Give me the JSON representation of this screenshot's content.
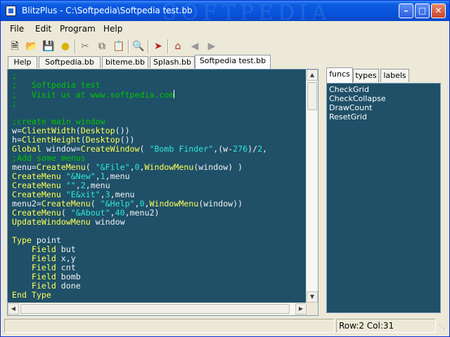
{
  "window": {
    "title": "BlitzPlus - C:\\Softpedia\\Softpedia test.bb",
    "controls": [
      "minimize",
      "maximize",
      "close"
    ]
  },
  "menubar": [
    "File",
    "Edit",
    "Program",
    "Help"
  ],
  "toolbar": {
    "icons": [
      "new-file-icon",
      "open-folder-icon",
      "save-disk-icon",
      "lightbulb-icon",
      "cut-icon",
      "copy-icon",
      "paste-icon",
      "find-magnifier-icon",
      "run-rocket-icon",
      "home-icon",
      "back-arrow-icon",
      "forward-arrow-icon"
    ]
  },
  "file_tabs": [
    {
      "label": "Help"
    },
    {
      "label": "Softpedia.bb"
    },
    {
      "label": "biteme.bb"
    },
    {
      "label": "Splash.bb"
    },
    {
      "label": "Softpedia test.bb",
      "active": true
    }
  ],
  "side_tabs": [
    {
      "label": "funcs",
      "active": true
    },
    {
      "label": "types"
    },
    {
      "label": "labels"
    }
  ],
  "side_list": [
    "CheckGrid",
    "CheckCollapse",
    "DrawCount",
    "ResetGrid"
  ],
  "status": {
    "left": "",
    "position": "Row:2 Col:31"
  },
  "colors": {
    "editor_bg": "#1f5068",
    "comment": "#00c400",
    "keyword": "#ffff55",
    "string": "#2ee8d8",
    "text": "#f2f2f2"
  },
  "code": [
    [
      [
        "c",
        ";"
      ]
    ],
    [
      [
        "c",
        ";   Softpedia test"
      ]
    ],
    [
      [
        "c",
        ";   Visit us at www.softpedia.com"
      ]
    ],
    [
      [
        "c",
        ";"
      ]
    ],
    [],
    [
      [
        "c",
        ";create main window"
      ]
    ],
    [
      [
        "t",
        "w="
      ],
      [
        "k",
        "ClientWidth"
      ],
      [
        "t",
        "("
      ],
      [
        "k",
        "Desktop"
      ],
      [
        "t",
        "())"
      ]
    ],
    [
      [
        "t",
        "h="
      ],
      [
        "k",
        "ClientHeight"
      ],
      [
        "t",
        "("
      ],
      [
        "k",
        "Desktop"
      ],
      [
        "t",
        "())"
      ]
    ],
    [
      [
        "k",
        "Global"
      ],
      [
        "t",
        " window="
      ],
      [
        "k",
        "CreateWindow"
      ],
      [
        "t",
        "( "
      ],
      [
        "s",
        "\"Bomb Finder\""
      ],
      [
        "t",
        ",(w-"
      ],
      [
        "n",
        "276"
      ],
      [
        "t",
        ")/"
      ],
      [
        "n",
        "2"
      ],
      [
        "t",
        ","
      ]
    ],
    [
      [
        "c",
        ";Add some menus"
      ]
    ],
    [
      [
        "t",
        "menu="
      ],
      [
        "k",
        "CreateMenu"
      ],
      [
        "t",
        "( "
      ],
      [
        "s",
        "\"&File\""
      ],
      [
        "t",
        ","
      ],
      [
        "n",
        "0"
      ],
      [
        "t",
        ","
      ],
      [
        "k",
        "WindowMenu"
      ],
      [
        "t",
        "(window) )"
      ]
    ],
    [
      [
        "k",
        "CreateMenu"
      ],
      [
        "t",
        " "
      ],
      [
        "s",
        "\"&New\""
      ],
      [
        "t",
        ","
      ],
      [
        "n",
        "1"
      ],
      [
        "t",
        ",menu"
      ]
    ],
    [
      [
        "k",
        "CreateMenu"
      ],
      [
        "t",
        " "
      ],
      [
        "s",
        "\"\""
      ],
      [
        "t",
        ","
      ],
      [
        "n",
        "2"
      ],
      [
        "t",
        ",menu"
      ]
    ],
    [
      [
        "k",
        "CreateMenu"
      ],
      [
        "t",
        " "
      ],
      [
        "s",
        "\"E&xit\""
      ],
      [
        "t",
        ","
      ],
      [
        "n",
        "3"
      ],
      [
        "t",
        ",menu"
      ]
    ],
    [
      [
        "t",
        "menu2="
      ],
      [
        "k",
        "CreateMenu"
      ],
      [
        "t",
        "( "
      ],
      [
        "s",
        "\"&Help\""
      ],
      [
        "t",
        ","
      ],
      [
        "n",
        "0"
      ],
      [
        "t",
        ","
      ],
      [
        "k",
        "WindowMenu"
      ],
      [
        "t",
        "(window))"
      ]
    ],
    [
      [
        "k",
        "CreateMenu"
      ],
      [
        "t",
        "( "
      ],
      [
        "s",
        "\"&About\""
      ],
      [
        "t",
        ","
      ],
      [
        "n",
        "40"
      ],
      [
        "t",
        ",menu2)"
      ]
    ],
    [
      [
        "k",
        "UpdateWindowMenu"
      ],
      [
        "t",
        " window"
      ]
    ],
    [],
    [
      [
        "k",
        "Type"
      ],
      [
        "t",
        " point"
      ]
    ],
    [
      [
        "t",
        "    "
      ],
      [
        "k",
        "Field"
      ],
      [
        "t",
        " but"
      ]
    ],
    [
      [
        "t",
        "    "
      ],
      [
        "k",
        "Field"
      ],
      [
        "t",
        " x,y"
      ]
    ],
    [
      [
        "t",
        "    "
      ],
      [
        "k",
        "Field"
      ],
      [
        "t",
        " cnt"
      ]
    ],
    [
      [
        "t",
        "    "
      ],
      [
        "k",
        "Field"
      ],
      [
        "t",
        " bomb"
      ]
    ],
    [
      [
        "t",
        "    "
      ],
      [
        "k",
        "Field"
      ],
      [
        "t",
        " done"
      ]
    ],
    [
      [
        "k",
        "End Type"
      ]
    ]
  ]
}
